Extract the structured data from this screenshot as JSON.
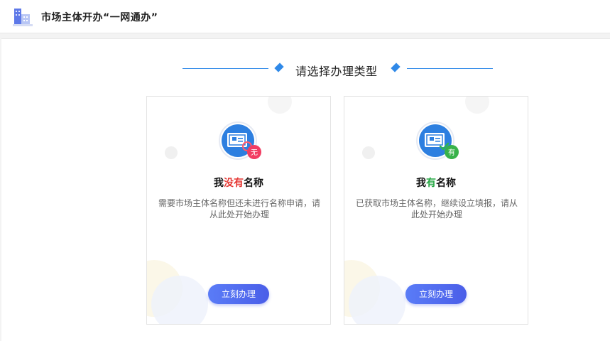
{
  "header": {
    "title": "市场主体开办“一网通办”"
  },
  "section": {
    "title": "请选择办理类型"
  },
  "colors": {
    "accent_blue": "#2f89e8",
    "button_start": "#5a7cf7",
    "button_end": "#4a5ee8",
    "red_highlight": "#e53935",
    "green_highlight": "#27a745"
  },
  "cards": [
    {
      "icon": "certificate-no-name-icon",
      "badge": "无",
      "title_prefix": "我",
      "title_highlight": "没有",
      "title_suffix": "名称",
      "description": "需要市场主体名称但还未进行名称申请，请从此处开始办理",
      "button_label": "立刻办理"
    },
    {
      "icon": "certificate-has-name-icon",
      "badge": "有",
      "title_prefix": "我",
      "title_highlight": "有",
      "title_suffix": "名称",
      "description": "已获取市场主体名称，继续设立填报，请从此处开始办理",
      "button_label": "立刻办理"
    }
  ]
}
